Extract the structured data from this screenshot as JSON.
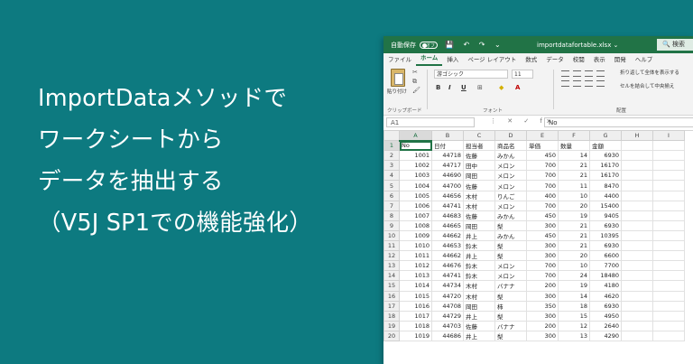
{
  "headline": [
    "ImportDataメソッドで",
    "ワークシートから",
    "データを抽出する",
    "（V5J SP1での機能強化）"
  ],
  "excel": {
    "autosave_label": "自動保存",
    "autosave_state": "オフ",
    "qat_icons": "💾 ↶ ↷ ⌄",
    "filename": "importdatafortable.xlsx ⌄",
    "search_label": "🔍 検索",
    "tabs": [
      "ファイル",
      "ホーム",
      "挿入",
      "ページ レイアウト",
      "数式",
      "データ",
      "校閲",
      "表示",
      "開発",
      "ヘルプ"
    ],
    "active_tab": "ホーム",
    "ribbon": {
      "paste_label": "貼り付け",
      "clipboard_label": "クリップボード",
      "font_name": "游ゴシック",
      "font_size": "11",
      "font_group_label": "フォント",
      "bold": "B",
      "italic": "I",
      "underline": "U",
      "wrap_text": "折り返して全体を表示する",
      "merge_center": "セルを結合して中央揃え",
      "alignment_label": "配置"
    },
    "name_box": "A1",
    "formula_value": "No",
    "accent_color": "#217346",
    "columns": [
      "A",
      "B",
      "C",
      "D",
      "E",
      "F",
      "G",
      "H",
      "I"
    ],
    "rows": [
      {
        "n": "1",
        "cells": [
          "No",
          "日付",
          "担当者",
          "商品名",
          "単価",
          "数量",
          "金額",
          "",
          ""
        ]
      },
      {
        "n": "2",
        "cells": [
          "1001",
          "44718",
          "佐藤",
          "みかん",
          "450",
          "14",
          "6930",
          "",
          ""
        ]
      },
      {
        "n": "3",
        "cells": [
          "1002",
          "44717",
          "田中",
          "メロン",
          "700",
          "21",
          "16170",
          "",
          ""
        ]
      },
      {
        "n": "4",
        "cells": [
          "1003",
          "44690",
          "岡田",
          "メロン",
          "700",
          "21",
          "16170",
          "",
          ""
        ]
      },
      {
        "n": "5",
        "cells": [
          "1004",
          "44700",
          "佐藤",
          "メロン",
          "700",
          "11",
          "8470",
          "",
          ""
        ]
      },
      {
        "n": "6",
        "cells": [
          "1005",
          "44656",
          "木村",
          "りんご",
          "400",
          "10",
          "4400",
          "",
          ""
        ]
      },
      {
        "n": "7",
        "cells": [
          "1006",
          "44741",
          "木村",
          "メロン",
          "700",
          "20",
          "15400",
          "",
          ""
        ]
      },
      {
        "n": "8",
        "cells": [
          "1007",
          "44683",
          "佐藤",
          "みかん",
          "450",
          "19",
          "9405",
          "",
          ""
        ]
      },
      {
        "n": "9",
        "cells": [
          "1008",
          "44665",
          "岡田",
          "梨",
          "300",
          "21",
          "6930",
          "",
          ""
        ]
      },
      {
        "n": "10",
        "cells": [
          "1009",
          "44662",
          "井上",
          "みかん",
          "450",
          "21",
          "10395",
          "",
          ""
        ]
      },
      {
        "n": "11",
        "cells": [
          "1010",
          "44653",
          "鈴木",
          "梨",
          "300",
          "21",
          "6930",
          "",
          ""
        ]
      },
      {
        "n": "12",
        "cells": [
          "1011",
          "44662",
          "井上",
          "梨",
          "300",
          "20",
          "6600",
          "",
          ""
        ]
      },
      {
        "n": "13",
        "cells": [
          "1012",
          "44676",
          "鈴木",
          "メロン",
          "700",
          "10",
          "7700",
          "",
          ""
        ]
      },
      {
        "n": "14",
        "cells": [
          "1013",
          "44741",
          "鈴木",
          "メロン",
          "700",
          "24",
          "18480",
          "",
          ""
        ]
      },
      {
        "n": "15",
        "cells": [
          "1014",
          "44734",
          "木村",
          "バナナ",
          "200",
          "19",
          "4180",
          "",
          ""
        ]
      },
      {
        "n": "16",
        "cells": [
          "1015",
          "44720",
          "木村",
          "梨",
          "300",
          "14",
          "4620",
          "",
          ""
        ]
      },
      {
        "n": "17",
        "cells": [
          "1016",
          "44708",
          "岡田",
          "柿",
          "350",
          "18",
          "6930",
          "",
          ""
        ]
      },
      {
        "n": "18",
        "cells": [
          "1017",
          "44729",
          "井上",
          "梨",
          "300",
          "15",
          "4950",
          "",
          ""
        ]
      },
      {
        "n": "19",
        "cells": [
          "1018",
          "44703",
          "佐藤",
          "バナナ",
          "200",
          "12",
          "2640",
          "",
          ""
        ]
      },
      {
        "n": "20",
        "cells": [
          "1019",
          "44686",
          "井上",
          "梨",
          "300",
          "13",
          "4290",
          "",
          ""
        ]
      }
    ]
  }
}
